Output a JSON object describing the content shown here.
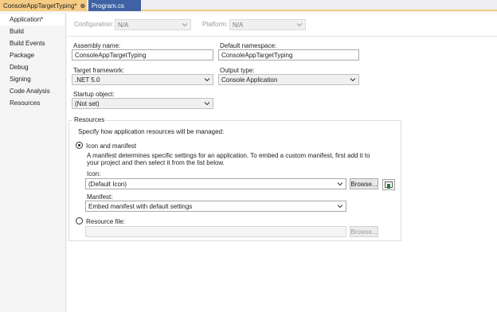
{
  "tabs": [
    {
      "label": "ConsoleAppTargetTyping*",
      "pin": "⊕",
      "close": "✕"
    },
    {
      "label": "Program.cs"
    }
  ],
  "sidebar": {
    "items": [
      {
        "label": "Application*"
      },
      {
        "label": "Build"
      },
      {
        "label": "Build Events"
      },
      {
        "label": "Package"
      },
      {
        "label": "Debug"
      },
      {
        "label": "Signing"
      },
      {
        "label": "Code Analysis"
      },
      {
        "label": "Resources"
      }
    ],
    "active_index": 0
  },
  "config": {
    "configuration_label": "Configuration:",
    "configuration_value": "N/A",
    "platform_label": "Platform:",
    "platform_value": "N/A"
  },
  "form": {
    "assembly_name_label": "Assembly name:",
    "assembly_name_value": "ConsoleAppTargetTyping",
    "default_namespace_label": "Default namespace:",
    "default_namespace_value": "ConsoleAppTargetTyping",
    "target_framework_label": "Target framework:",
    "target_framework_value": ".NET 5.0",
    "output_type_label": "Output type:",
    "output_type_value": "Console Application",
    "startup_object_label": "Startup object:",
    "startup_object_value": "(Not set)"
  },
  "resources": {
    "group_title": "Resources",
    "description": "Specify how application resources will be managed:",
    "icon_manifest_label": "Icon and manifest",
    "icon_manifest_selected": true,
    "manifest_help_line1": "A manifest determines specific settings for an application. To embed a custom manifest, first add it to",
    "manifest_help_line2": "your project and then select it from the list below.",
    "icon_label": "Icon:",
    "icon_value": "(Default Icon)",
    "browse_label": "Browse...",
    "manifest_label": "Manifest:",
    "manifest_value": "Embed manifest with default settings",
    "resource_file_label": "Resource file:",
    "resource_file_value": "",
    "resource_browse_label": "Browse..."
  },
  "colors": {
    "active_tab": "#f5cc84",
    "inactive_tab": "#3f62a5",
    "icon_green": "#2a7a3a"
  }
}
